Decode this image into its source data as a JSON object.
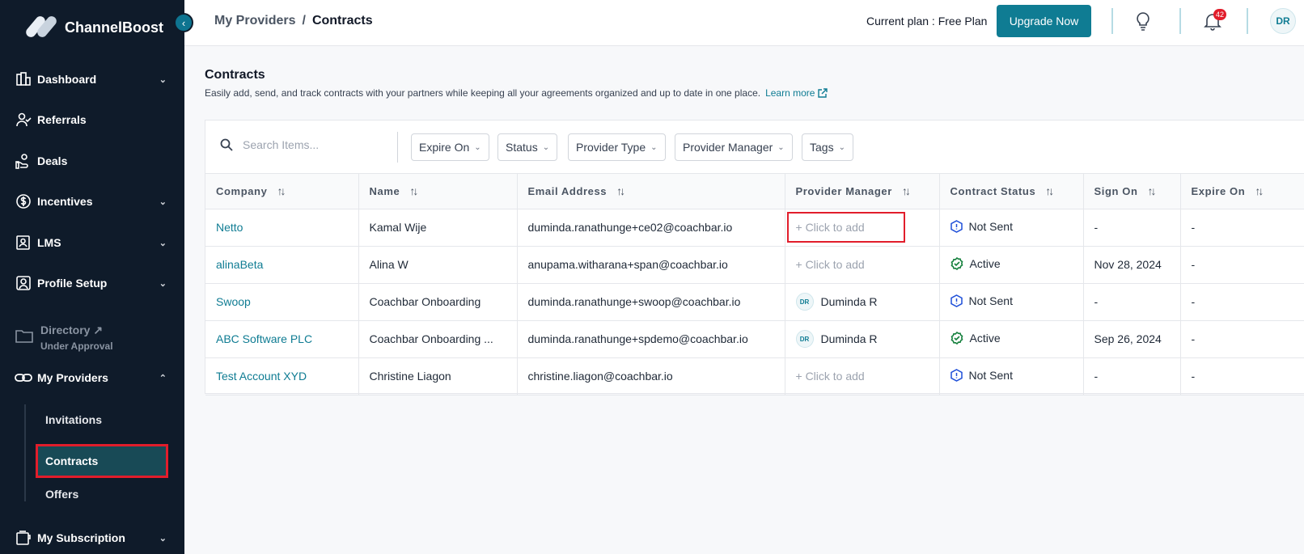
{
  "brand": {
    "name": "ChannelBoost"
  },
  "sidebar": {
    "items": [
      {
        "label": "Dashboard",
        "icon": "dashboard-icon",
        "chevron": "down"
      },
      {
        "label": "Referrals",
        "icon": "referrals-icon"
      },
      {
        "label": "Deals",
        "icon": "deals-icon"
      },
      {
        "label": "Incentives",
        "icon": "dollar-circle-icon",
        "chevron": "down"
      },
      {
        "label": "LMS",
        "icon": "lms-icon",
        "chevron": "down"
      },
      {
        "label": "Profile Setup",
        "icon": "profile-icon",
        "chevron": "down"
      }
    ],
    "directory": {
      "label": "Directory",
      "sublabel": "Under Approval"
    },
    "my_providers": {
      "label": "My Providers",
      "chevron": "up"
    },
    "sub_items": [
      "Invitations",
      "Contracts",
      "Offers"
    ],
    "my_subscription": {
      "label": "My Subscription"
    }
  },
  "header": {
    "breadcrumb_parent": "My Providers",
    "breadcrumb_sep": "/",
    "breadcrumb_current": "Contracts",
    "plan_text": "Current plan : Free Plan",
    "upgrade_label": "Upgrade Now",
    "notification_count": "42",
    "avatar_initials": "DR"
  },
  "main": {
    "title": "Contracts",
    "description": "Easily add, send, and track contracts with your partners while keeping all your agreements organized and up to date in one place.",
    "learn_more": "Learn more"
  },
  "filters": {
    "search_placeholder": "Search Items...",
    "buttons": [
      "Expire On",
      "Status",
      "Provider Type",
      "Provider Manager",
      "Tags"
    ]
  },
  "table": {
    "columns": [
      "Company",
      "Name",
      "Email Address",
      "Provider Manager",
      "Contract Status",
      "Sign On",
      "Expire On"
    ],
    "rows": [
      {
        "company": "Netto",
        "name": "Kamal Wije",
        "email": "duminda.ranathunge+ce02@coachbar.io",
        "manager": "+ Click to add",
        "status": "Not Sent",
        "sign_on": "-",
        "expire_on": "-"
      },
      {
        "company": "alinaBeta",
        "name": "Alina W",
        "email": "anupama.witharana+span@coachbar.io",
        "manager": "+ Click to add",
        "status": "Active",
        "sign_on": "Nov 28, 2024",
        "expire_on": "-"
      },
      {
        "company": "Swoop",
        "name": "Coachbar Onboarding",
        "email": "duminda.ranathunge+swoop@coachbar.io",
        "manager": "Duminda R",
        "manager_initials": "DR",
        "status": "Not Sent",
        "sign_on": "-",
        "expire_on": "-"
      },
      {
        "company": "ABC Software PLC",
        "name": "Coachbar Onboarding ...",
        "email": "duminda.ranathunge+spdemo@coachbar.io",
        "manager": "Duminda R",
        "manager_initials": "DR",
        "status": "Active",
        "sign_on": "Sep 26, 2024",
        "expire_on": "-"
      },
      {
        "company": "Test Account XYD",
        "name": "Christine Liagon",
        "email": "christine.liagon@coachbar.io",
        "manager": "+ Click to add",
        "status": "Not Sent",
        "sign_on": "-",
        "expire_on": "-"
      }
    ]
  },
  "colors": {
    "sidebar_bg": "#0f1b2a",
    "accent": "#0f7c93",
    "highlight": "#e11d2b",
    "active_green": "#15803d",
    "not_sent_blue": "#1d4ed8"
  }
}
